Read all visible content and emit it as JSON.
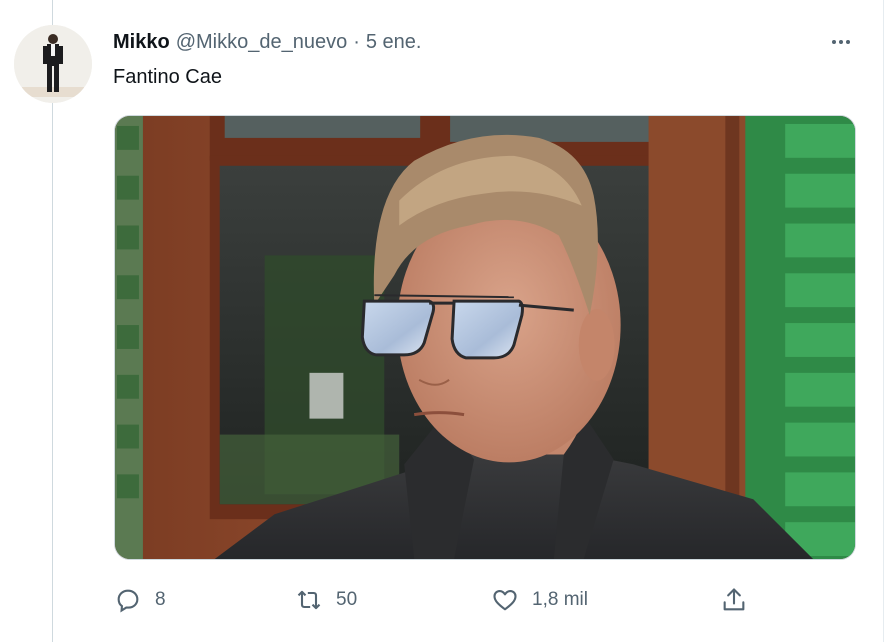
{
  "tweet": {
    "author_name": "Mikko",
    "author_handle": "@Mikko_de_nuevo",
    "separator": "·",
    "date": "5 ene.",
    "text": "Fantino Cae"
  },
  "actions": {
    "reply_count": "8",
    "retweet_count": "50",
    "like_count": "1,8 mil"
  },
  "icons": [
    "more-icon",
    "reply-icon",
    "retweet-icon",
    "like-icon",
    "share-icon"
  ],
  "colors": {
    "text_primary": "#0f1419",
    "text_secondary": "#536471",
    "border": "#cfd9de"
  }
}
